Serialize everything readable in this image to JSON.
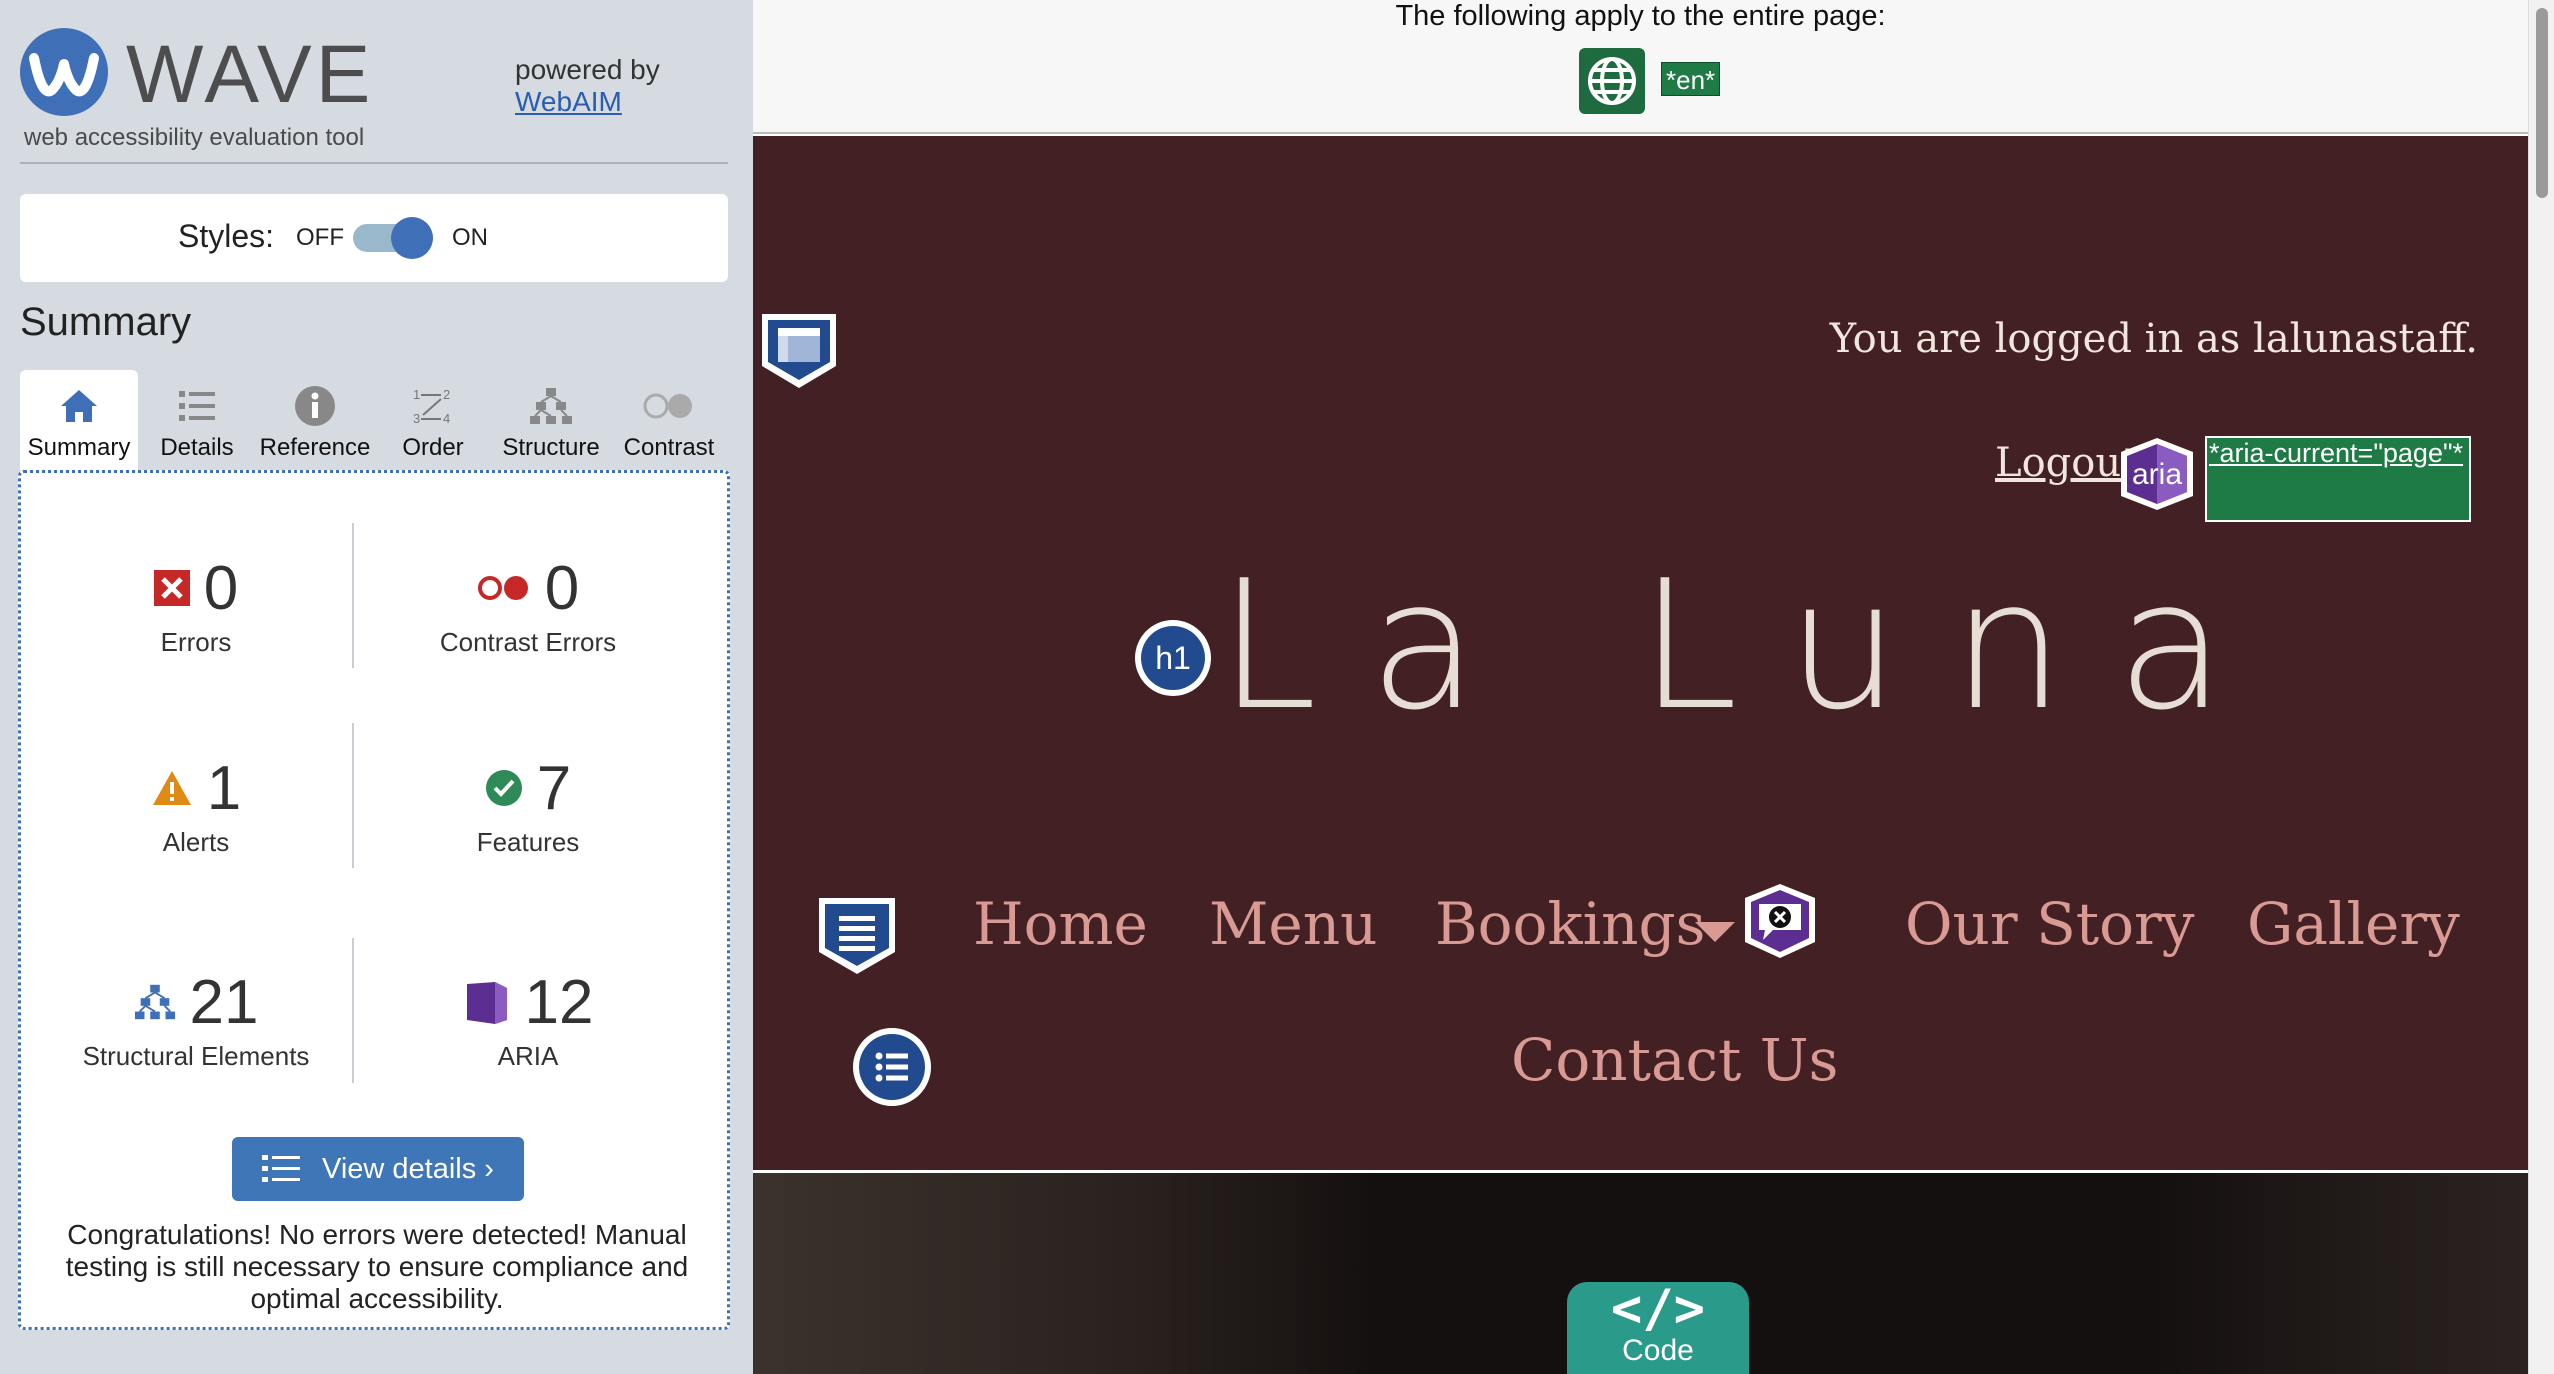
{
  "wave": {
    "brand": "WAVE",
    "tagline": "web accessibility evaluation tool",
    "powered_by": "powered by",
    "powered_link": "WebAIM"
  },
  "styles": {
    "label": "Styles:",
    "off": "OFF",
    "on": "ON",
    "state": "on"
  },
  "summary_heading": "Summary",
  "tabs": [
    {
      "label": "Summary",
      "icon": "home-icon",
      "active": true
    },
    {
      "label": "Details",
      "icon": "list-icon"
    },
    {
      "label": "Reference",
      "icon": "info-icon"
    },
    {
      "label": "Order",
      "icon": "order-icon"
    },
    {
      "label": "Structure",
      "icon": "structure-icon"
    },
    {
      "label": "Contrast",
      "icon": "contrast-icon"
    }
  ],
  "stats": {
    "errors": {
      "value": "0",
      "label": "Errors"
    },
    "contrast_errors": {
      "value": "0",
      "label": "Contrast Errors"
    },
    "alerts": {
      "value": "1",
      "label": "Alerts"
    },
    "features": {
      "value": "7",
      "label": "Features"
    },
    "structural": {
      "value": "21",
      "label": "Structural Elements"
    },
    "aria": {
      "value": "12",
      "label": "ARIA"
    }
  },
  "view_details": "View details ›",
  "congrats": "Congratulations! No errors were detected! Manual testing is still necessary to ensure compliance and optimal accessibility.",
  "page": {
    "apply_text": "The following apply to the entire page:",
    "lang_badge": "*en*",
    "logged_in": "You are logged in as lalunastaff.",
    "logout": "Logout",
    "aria_badge": "aria",
    "aria_current": "*aria-current=\"page\"*",
    "h1_badge": "h1",
    "brand": "La Luna",
    "nav": [
      "Home",
      "Menu",
      "Bookings",
      "Our Story",
      "Gallery",
      "Contact Us"
    ],
    "code_glyph": "</>",
    "code_label": "Code"
  },
  "colors": {
    "wave_blue": "#3f6fb7",
    "sidebar_bg": "#d6dbe2",
    "header_bg": "#432024",
    "nav_text": "#d99a93",
    "wave_green": "#1e7b45",
    "aria_purple": "#5c2e91"
  }
}
